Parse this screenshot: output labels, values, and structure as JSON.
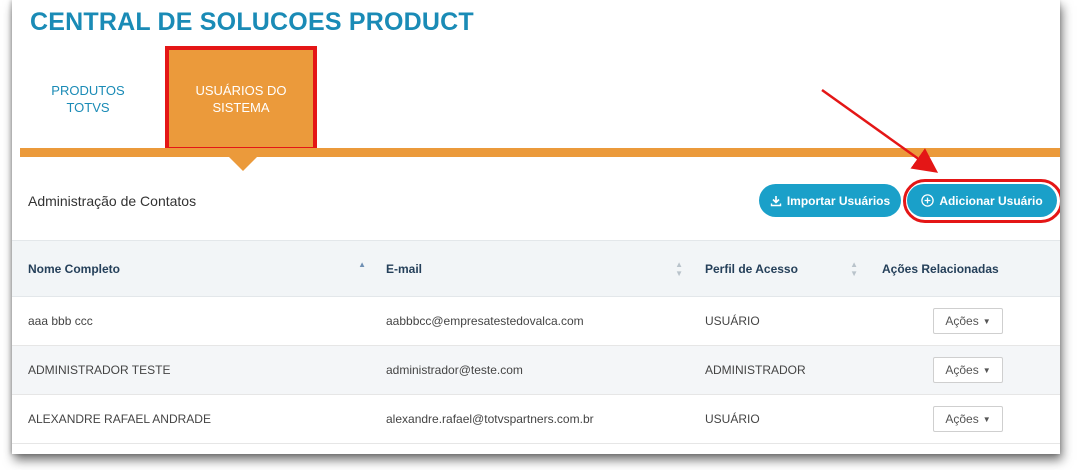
{
  "header": {
    "title": "CENTRAL DE SOLUCOES PRODUCT"
  },
  "tabs": [
    {
      "line1": "PRODUTOS",
      "line2": "TOTVS",
      "active": false
    },
    {
      "line1": "USUÁRIOS DO",
      "line2": "SISTEMA",
      "active": true
    }
  ],
  "section": {
    "title": "Administração de Contatos",
    "import_label": "Importar Usuários",
    "add_label": "Adicionar Usuário"
  },
  "table": {
    "columns": [
      "Nome Completo",
      "E-mail",
      "Perfil de Acesso",
      "Ações Relacionadas"
    ],
    "sorted_column": "Nome Completo",
    "rows": [
      {
        "name": "aaa bbb ccc",
        "email": "aabbbcc@empresatestedovalca.com",
        "profile": "USUÁRIO",
        "action": "Ações"
      },
      {
        "name": "ADMINISTRADOR TESTE",
        "email": "administrador@teste.com",
        "profile": "ADMINISTRADOR",
        "action": "Ações"
      },
      {
        "name": "ALEXANDRE RAFAEL ANDRADE",
        "email": "alexandre.rafael@totvspartners.com.br",
        "profile": "USUÁRIO",
        "action": "Ações"
      }
    ]
  },
  "icons": {
    "import": "download-icon",
    "add": "plus-circle-icon",
    "dropdown": "caret-down-icon",
    "sort": "sort-icon"
  },
  "colors": {
    "brand": "#1a8bb6",
    "tab_active": "#eb9a3b",
    "button": "#1aa0c9",
    "highlight": "#e41616"
  }
}
